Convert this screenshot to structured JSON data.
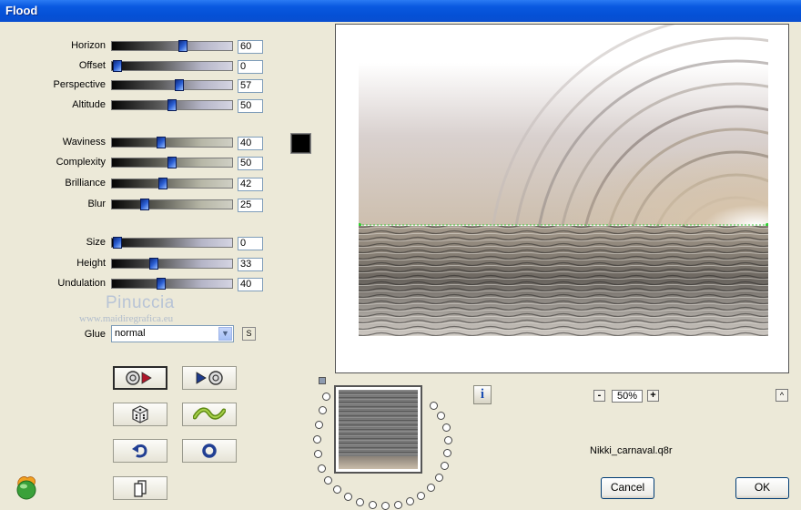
{
  "window": {
    "title": "Flood"
  },
  "sliders": [
    {
      "label": "Horizon",
      "value": "60",
      "fraction": 0.6,
      "style": "a"
    },
    {
      "label": "Offset",
      "value": "0",
      "fraction": 0.0,
      "style": "a"
    },
    {
      "label": "Perspective",
      "value": "57",
      "fraction": 0.57,
      "style": "a"
    },
    {
      "label": "Altitude",
      "value": "50",
      "fraction": 0.5,
      "style": "a"
    },
    {
      "label": "Waviness",
      "value": "40",
      "fraction": 0.4,
      "style": "b"
    },
    {
      "label": "Complexity",
      "value": "50",
      "fraction": 0.5,
      "style": "b"
    },
    {
      "label": "Brilliance",
      "value": "42",
      "fraction": 0.42,
      "style": "b"
    },
    {
      "label": "Blur",
      "value": "25",
      "fraction": 0.25,
      "style": "b"
    },
    {
      "label": "Size",
      "value": "0",
      "fraction": 0.0,
      "style": "a"
    },
    {
      "label": "Height",
      "value": "33",
      "fraction": 0.33,
      "style": "a"
    },
    {
      "label": "Undulation",
      "value": "40",
      "fraction": 0.4,
      "style": "a"
    }
  ],
  "color_swatch": "#000000",
  "watermark": {
    "name": "Pinuccia",
    "url": "www.maidiregrafica.eu"
  },
  "glue": {
    "label": "Glue",
    "value": "normal",
    "button_label": "S"
  },
  "preset_buttons": [
    {
      "name": "previous-preset-button",
      "icon": "reel-arrow-right-icon",
      "pressed": true
    },
    {
      "name": "next-preset-button",
      "icon": "arrow-reel-icon",
      "pressed": false
    },
    {
      "name": "randomize-button",
      "icon": "dice-icon",
      "pressed": false
    },
    {
      "name": "wave-button",
      "icon": "wave-icon",
      "pressed": false
    },
    {
      "name": "undo-button",
      "icon": "undo-arrow-icon",
      "pressed": false
    },
    {
      "name": "reset-button",
      "icon": "ring-icon",
      "pressed": false
    },
    {
      "name": "copy-button",
      "icon": "copy-page-icon",
      "pressed": false
    }
  ],
  "info_label": "i",
  "zoom": {
    "minus": "-",
    "value": "50%",
    "plus": "+"
  },
  "scroll_up_label": "^",
  "filename": "Nikki_carnaval.q8r",
  "buttons": {
    "cancel": "Cancel",
    "ok": "OK"
  }
}
